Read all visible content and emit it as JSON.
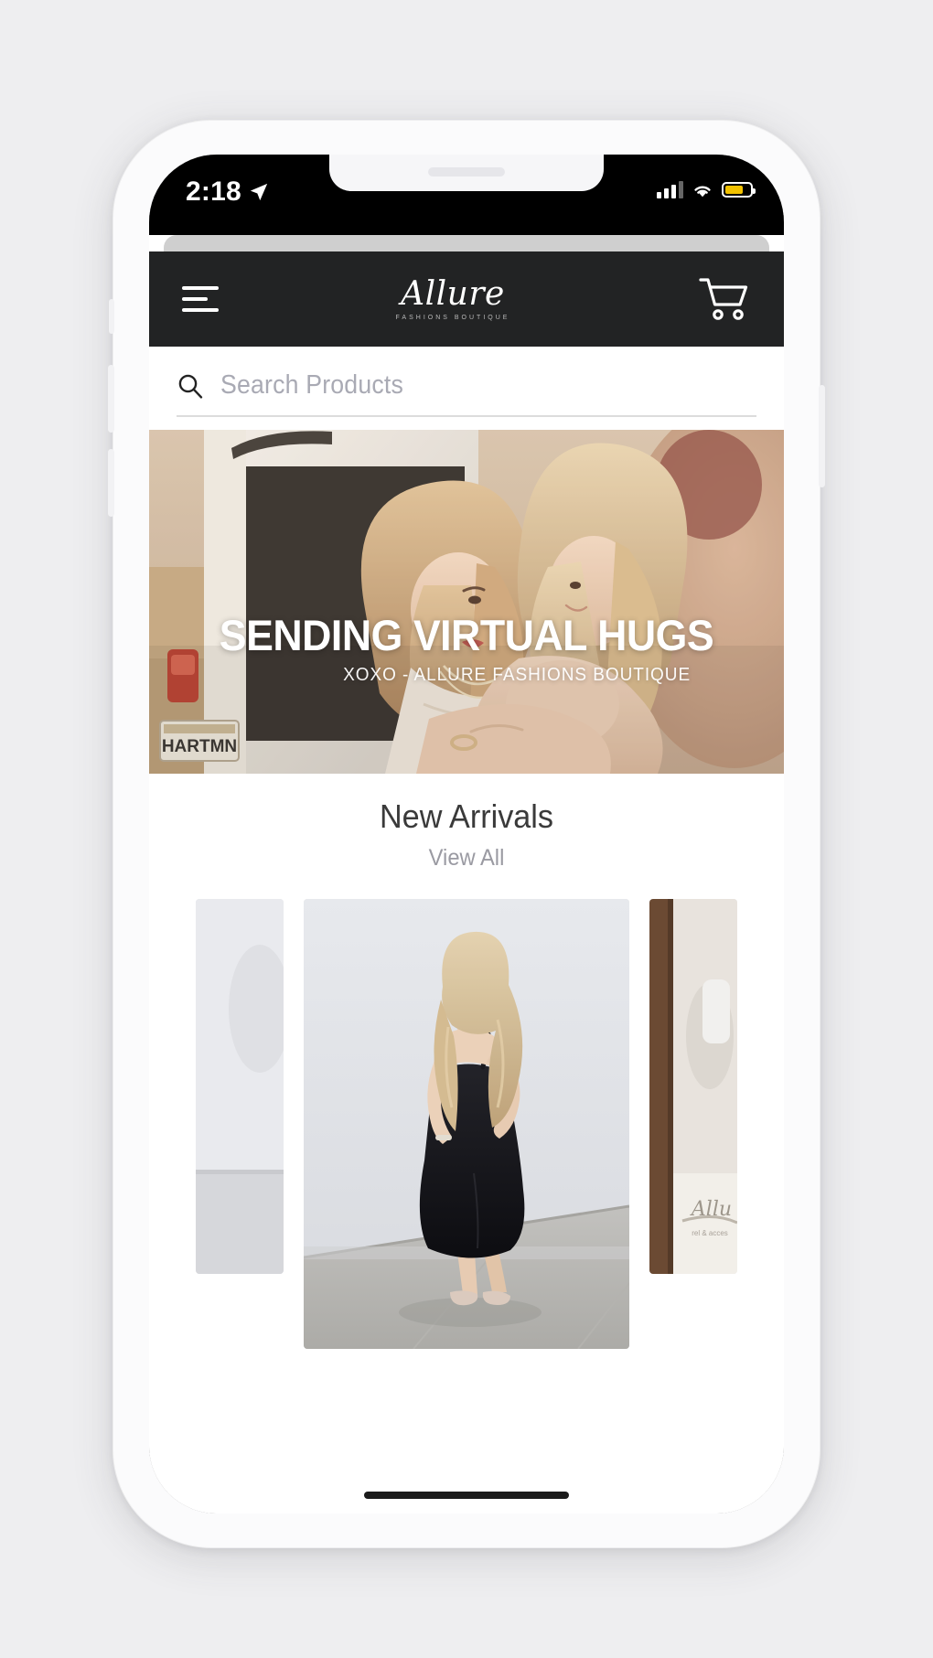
{
  "device": {
    "status_bar": {
      "time": "2:18",
      "location_icon": "location-arrow-icon",
      "signal_icon": "cellular-signal-icon",
      "signal_bars_filled": 3,
      "signal_bars_total": 4,
      "wifi_icon": "wifi-icon",
      "battery_icon": "battery-icon",
      "battery_color": "#f2c200",
      "battery_level_percent": 72
    }
  },
  "header": {
    "menu_icon": "hamburger-menu-icon",
    "brand_name": "Allure",
    "brand_subtitle": "FASHIONS BOUTIQUE",
    "cart_icon": "shopping-cart-icon",
    "background_color": "#222324"
  },
  "search": {
    "icon": "search-icon",
    "value": "",
    "placeholder": "Search Products"
  },
  "hero": {
    "headline": "SENDING VIRTUAL HUGS",
    "subheadline": "XOXO - ALLURE FASHIONS BOUTIQUE",
    "alt": "Two women sitting in the open back of a van"
  },
  "new_arrivals": {
    "title": "New Arrivals",
    "view_all_label": "View All",
    "products": [
      {
        "alt": "Model in light outfit against white wall",
        "position": "left-partial"
      },
      {
        "alt": "Blonde model in black midi slip dress against white wall",
        "position": "center"
      },
      {
        "alt": "Model in boutique doorway with Allure logo mat",
        "position": "right-partial"
      }
    ]
  },
  "colors": {
    "header_bg": "#222324",
    "page_bg": "#ffffff",
    "text_primary": "#3a3a3a",
    "text_muted": "#9a9aa2",
    "battery_yellow": "#f2c200"
  }
}
